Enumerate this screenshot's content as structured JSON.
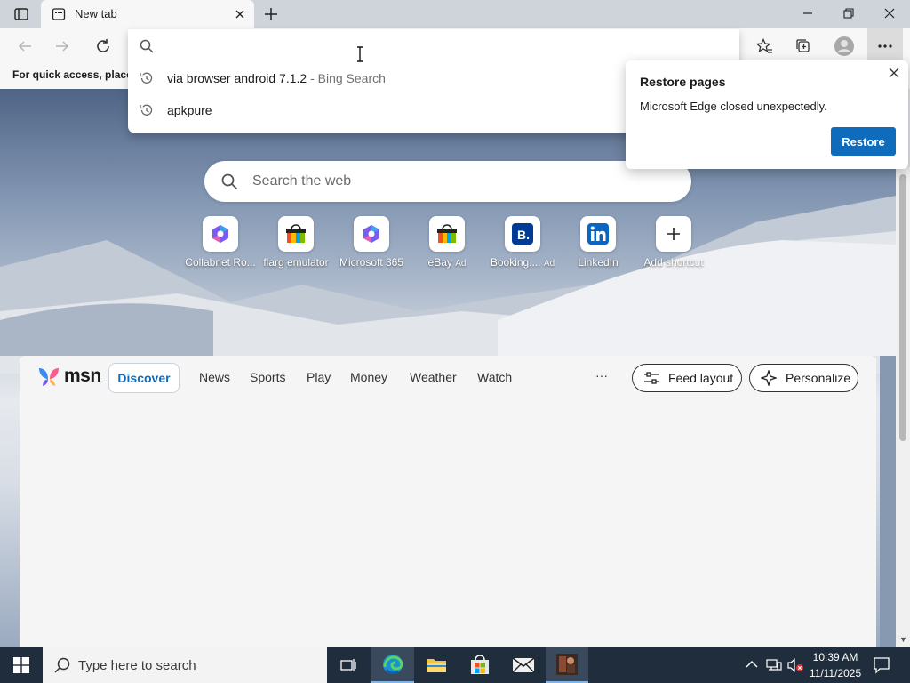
{
  "window": {
    "tab_title": "New tab"
  },
  "address_bar": {
    "value": "",
    "suggestions": [
      {
        "text": "via browser android 7.1.2",
        "suffix": " - Bing Search"
      },
      {
        "text": "apkpure",
        "suffix": ""
      }
    ]
  },
  "favorites_bar": {
    "text": "For quick access, place y"
  },
  "new_tab_page": {
    "search_placeholder": "Search the web",
    "shortcuts": [
      {
        "label": "Collabnet Ro...",
        "ad": "",
        "icon": "m365-icon"
      },
      {
        "label": "flarg emulator",
        "ad": "",
        "icon": "store-bag-icon"
      },
      {
        "label": "Microsoft 365",
        "ad": "",
        "icon": "m365-icon"
      },
      {
        "label": "eBay",
        "ad": "Ad",
        "icon": "store-bag-icon"
      },
      {
        "label": "Booking....",
        "ad": "Ad",
        "icon": "booking-icon"
      },
      {
        "label": "LinkedIn",
        "ad": "",
        "icon": "linkedin-icon"
      },
      {
        "label": "Add shortcut",
        "ad": "",
        "icon": "plus-icon"
      }
    ]
  },
  "restore_popup": {
    "title": "Restore pages",
    "message": "Microsoft Edge closed unexpectedly.",
    "button": "Restore"
  },
  "msn": {
    "logo": "msn",
    "tabs": [
      "Discover",
      "News",
      "Sports",
      "Play",
      "Money",
      "Weather",
      "Watch"
    ],
    "more": "···",
    "feed_layout": "Feed layout",
    "personalize": "Personalize"
  },
  "taskbar": {
    "search_placeholder": "Type here to search",
    "time": "10:39 AM",
    "date": "11/11/2025"
  },
  "colors": {
    "accent": "#0f6cbd",
    "taskbar": "#1f2d3d"
  }
}
